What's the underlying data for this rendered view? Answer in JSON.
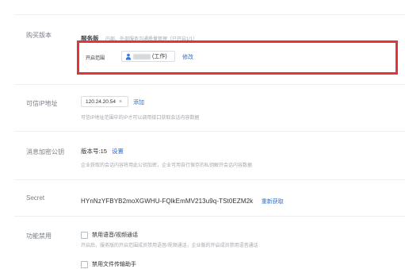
{
  "edition": {
    "label": "购买版本",
    "name": "服务版",
    "description": "内部、外部服务沟通质量管理（已开启1/1）",
    "scope_label": "开启范围",
    "member_suffix": "(工作)",
    "edit": "修改"
  },
  "trusted_ip": {
    "label": "可信IP地址",
    "ip": "120.24.20.54",
    "remove_glyph": "×",
    "add": "添加",
    "hint": "可信IP地址范围中的IP才可以调用接口获取会话内容数据"
  },
  "encryption": {
    "label": "消息加密公钥",
    "version": "版本号:15",
    "settings": "设置",
    "hint": "企业获取的会话内容将用此公钥加密，企业可用自行保存的私钥解开会话内容数据"
  },
  "secret": {
    "label": "Secret",
    "value": "HYnNzYFBYB2moXGWHU-FQlkEmMV213u9q-TSt0EZM2k",
    "refresh": "重新获取"
  },
  "feature_disable": {
    "label": "功能禁用",
    "options": [
      {
        "label": "禁用语音/视频通话",
        "checked": false
      },
      {
        "label": "禁用文件传输助手",
        "checked": false
      }
    ],
    "hint": "开启后，服务版的开启范围成员禁用语音/视频通话，企业版的开启成员禁用语音通话"
  },
  "colors": {
    "highlight_border": "#e5333a",
    "link": "#2f6ec7"
  },
  "icons": {
    "member": "person-icon"
  }
}
